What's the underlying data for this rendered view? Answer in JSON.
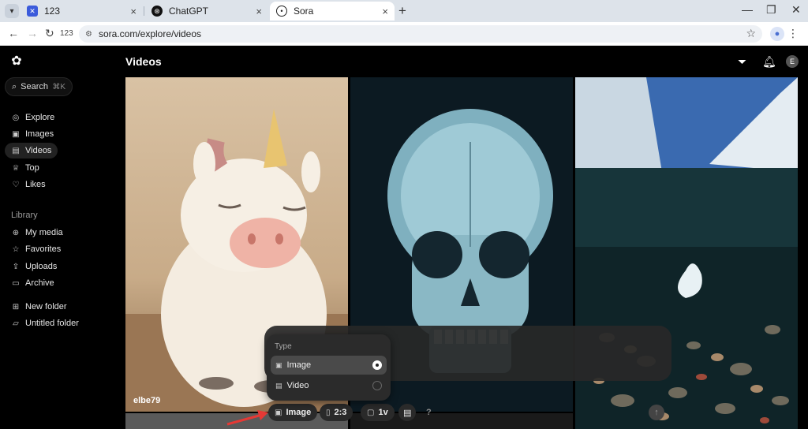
{
  "browser": {
    "tabs": [
      {
        "title": "123"
      },
      {
        "title": "ChatGPT"
      },
      {
        "title": "Sora"
      }
    ],
    "address_badge": "123",
    "url": "sora.com/explore/videos"
  },
  "sidebar": {
    "search_label": "Search",
    "search_shortcut": "⌘K",
    "items": [
      {
        "label": "Explore",
        "icon": "compass-icon"
      },
      {
        "label": "Images",
        "icon": "image-icon"
      },
      {
        "label": "Videos",
        "icon": "video-icon"
      },
      {
        "label": "Top",
        "icon": "trophy-icon"
      },
      {
        "label": "Likes",
        "icon": "heart-icon"
      }
    ],
    "library_label": "Library",
    "library_items": [
      {
        "label": "My media",
        "icon": "media-icon"
      },
      {
        "label": "Favorites",
        "icon": "star-icon"
      },
      {
        "label": "Uploads",
        "icon": "upload-icon"
      },
      {
        "label": "Archive",
        "icon": "archive-icon"
      }
    ],
    "folders": [
      {
        "label": "New folder",
        "icon": "new-folder-icon"
      },
      {
        "label": "Untitled folder",
        "icon": "folder-icon"
      }
    ]
  },
  "main": {
    "title": "Videos",
    "tiles": [
      {
        "caption": "elbe79",
        "subject": "plush unicorn"
      },
      {
        "caption": "",
        "subject": "x-ray skull"
      },
      {
        "caption": "",
        "subject": "glacier lake pebbles"
      }
    ]
  },
  "composer": {
    "type_button_label": "Image",
    "aspect_label": "2:3",
    "variations_label": "1v",
    "help_label": "?"
  },
  "type_dropdown": {
    "heading": "Type",
    "options": [
      {
        "label": "Image",
        "selected": true
      },
      {
        "label": "Video",
        "selected": false
      }
    ]
  },
  "colors": {
    "accent": "#e53935",
    "background": "#000000"
  }
}
